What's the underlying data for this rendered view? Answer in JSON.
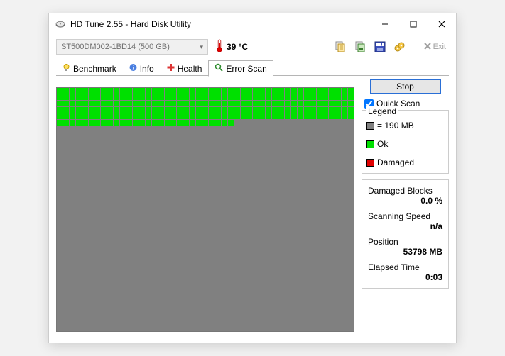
{
  "window": {
    "title": "HD Tune 2.55 - Hard Disk Utility"
  },
  "drive": {
    "selected": "ST500DM002-1BD14 (500 GB)"
  },
  "temperature": {
    "value": "39 °C"
  },
  "exit_label": "Exit",
  "tabs": {
    "benchmark": "Benchmark",
    "info": "Info",
    "health": "Health",
    "error_scan": "Error Scan"
  },
  "scan": {
    "stop_label": "Stop",
    "quick_scan_label": "Quick Scan",
    "quick_scan_checked": true,
    "grid_cols": 47,
    "grid_rows": 38,
    "full_ok_rows": 5,
    "partial_row_ok_cols": 28
  },
  "legend": {
    "title": "Legend",
    "block_size": "= 190 MB",
    "ok": "Ok",
    "damaged": "Damaged"
  },
  "stats": {
    "damaged_blocks_label": "Damaged Blocks",
    "damaged_blocks_value": "0.0 %",
    "scanning_speed_label": "Scanning Speed",
    "scanning_speed_value": "n/a",
    "position_label": "Position",
    "position_value": "53798 MB",
    "elapsed_label": "Elapsed Time",
    "elapsed_value": "0:03"
  }
}
